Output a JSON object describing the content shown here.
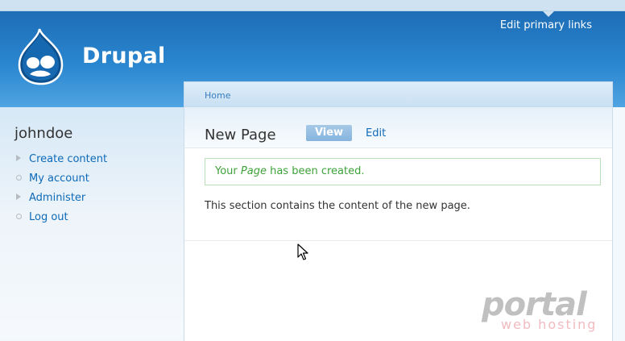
{
  "header": {
    "site_name": "Drupal",
    "primary_links": "Edit primary links",
    "colors": {
      "header_blue": "#2a86cf",
      "link_blue": "#0d6ab8"
    }
  },
  "sidebar": {
    "username": "johndoe",
    "items": [
      {
        "label": "Create content",
        "bullet": "triangle"
      },
      {
        "label": "My account",
        "bullet": "circle"
      },
      {
        "label": "Administer",
        "bullet": "triangle"
      },
      {
        "label": "Log out",
        "bullet": "circle"
      }
    ]
  },
  "content": {
    "breadcrumb": "Home",
    "title": "New Page",
    "tabs": [
      {
        "label": "View",
        "active": true
      },
      {
        "label": "Edit",
        "active": false
      }
    ],
    "message": {
      "prefix": "Your ",
      "emph": "Page",
      "suffix": " has been created."
    },
    "body": "This section contains the content of the new page."
  },
  "watermark": {
    "main": "portal",
    "sub": "web hosting"
  }
}
